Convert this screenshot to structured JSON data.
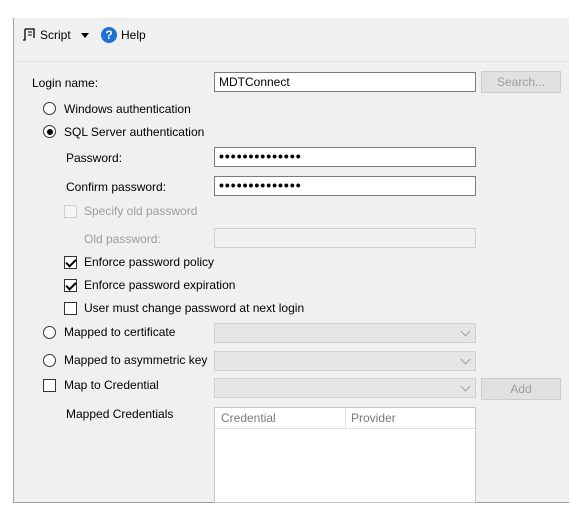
{
  "toolbar": {
    "script_label": "Script",
    "help_label": "Help"
  },
  "login": {
    "label": "Login name:",
    "value": "MDTConnect",
    "search_button": "Search..."
  },
  "auth": {
    "windows": "Windows authentication",
    "sql": "SQL Server authentication",
    "selected": "sql"
  },
  "password": {
    "label": "Password:",
    "value": "••••••••••••••"
  },
  "confirm_password": {
    "label": "Confirm password:",
    "value": "••••••••••••••"
  },
  "specify_old": {
    "label": "Specify old password",
    "checked": false,
    "enabled": false
  },
  "old_password": {
    "label": "Old password:",
    "value": ""
  },
  "policy": {
    "enforce_policy": "Enforce password policy",
    "enforce_expiration": "Enforce password expiration",
    "must_change": "User must change password at next login"
  },
  "mapping": {
    "certificate": "Mapped to certificate",
    "asymmetric_key": "Mapped to asymmetric key",
    "credential": "Map to Credential",
    "add_button": "Add",
    "mapped_credentials": "Mapped Credentials"
  },
  "credentials_grid": {
    "columns": [
      "Credential",
      "Provider"
    ]
  }
}
